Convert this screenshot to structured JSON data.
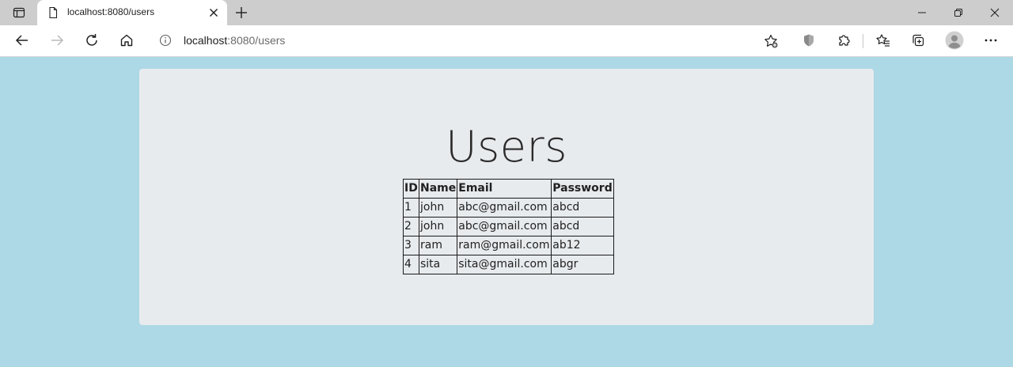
{
  "browser": {
    "tab_title": "localhost:8080/users",
    "url_host": "localhost",
    "url_path": ":8080/users"
  },
  "page": {
    "title": "Users"
  },
  "table": {
    "headers": [
      "ID",
      "Name",
      "Email",
      "Password"
    ],
    "rows": [
      [
        "1",
        "john",
        "abc@gmail.com",
        "abcd"
      ],
      [
        "2",
        "john",
        "abc@gmail.com",
        "abcd"
      ],
      [
        "3",
        "ram",
        "ram@gmail.com",
        "ab12"
      ],
      [
        "4",
        "sita",
        "sita@gmail.com",
        "abgr"
      ]
    ]
  },
  "icons": {
    "tab_actions": "tab-actions-icon",
    "favicon": "page-icon",
    "back": "back-arrow-icon",
    "forward": "forward-arrow-icon",
    "refresh": "refresh-icon",
    "home": "home-icon",
    "info": "info-icon",
    "favorite": "add-favorite-icon",
    "tracking": "shield-icon",
    "extensions": "puzzle-icon",
    "favorites": "favorites-icon",
    "collections": "collections-icon",
    "profile": "profile-avatar-icon",
    "menu": "more-dots-icon"
  },
  "colors": {
    "page_background": "#add8e6",
    "card_background": "#e8ebee",
    "tabstrip": "#cdcdcd"
  }
}
